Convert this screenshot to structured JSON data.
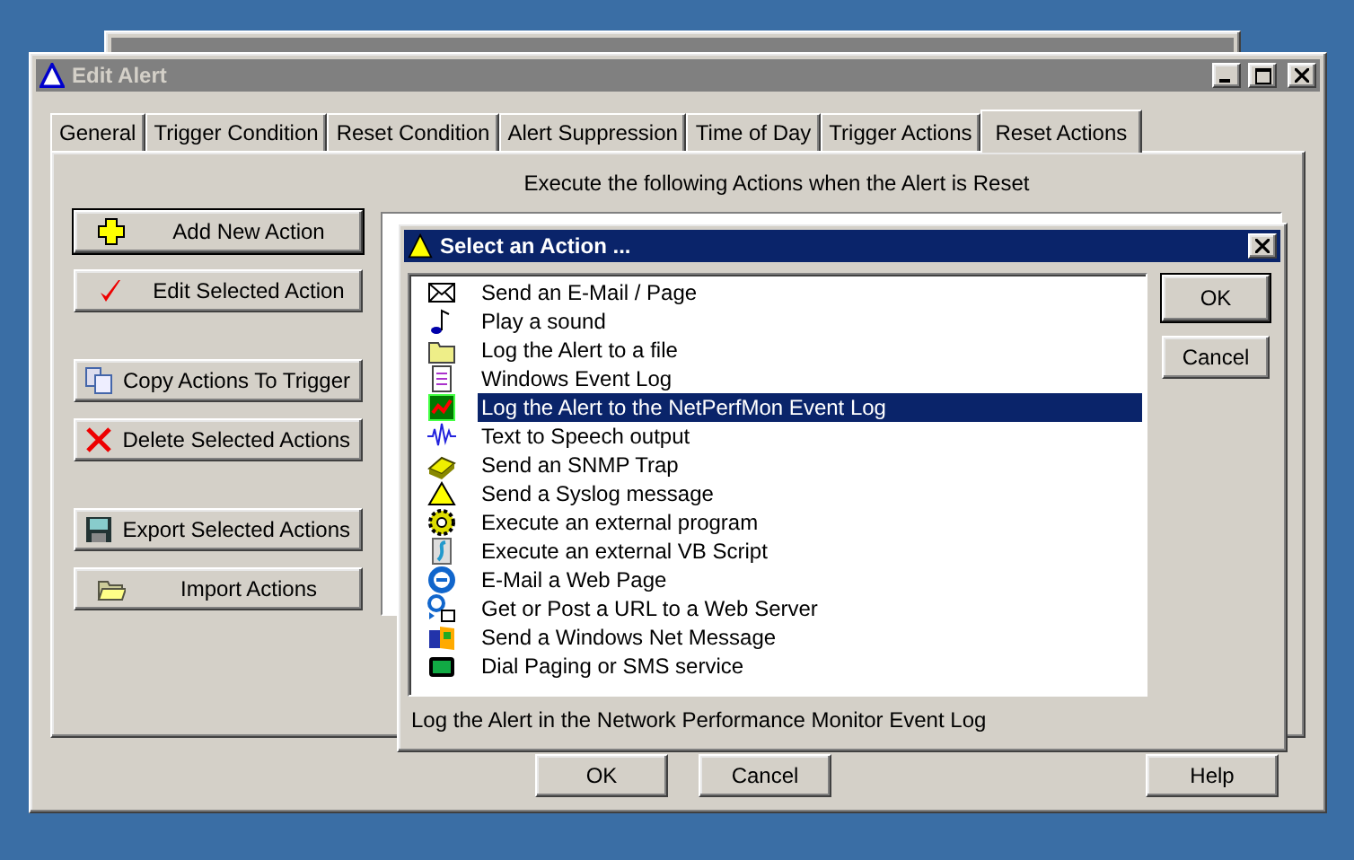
{
  "edit_alert": {
    "title": "Edit Alert",
    "tabs": [
      {
        "label": "General",
        "selected": false
      },
      {
        "label": "Trigger Condition",
        "selected": false
      },
      {
        "label": "Reset Condition",
        "selected": false
      },
      {
        "label": "Alert Suppression",
        "selected": false
      },
      {
        "label": "Time of Day",
        "selected": false
      },
      {
        "label": "Trigger Actions",
        "selected": false
      },
      {
        "label": "Reset Actions",
        "selected": true
      }
    ],
    "heading": "Execute the following Actions when the Alert is Reset",
    "action_button_groups": [
      [
        {
          "label": "Add New Action",
          "default": true
        },
        {
          "label": "Edit Selected Action",
          "default": false
        }
      ],
      [
        {
          "label": "Copy Actions To Trigger",
          "default": false
        },
        {
          "label": "Delete Selected Actions",
          "default": false
        }
      ],
      [
        {
          "label": "Export Selected Actions",
          "default": false
        },
        {
          "label": "Import Actions",
          "default": false
        }
      ]
    ],
    "buttons": [
      {
        "label": "OK"
      },
      {
        "label": "Cancel"
      },
      {
        "label": "Help"
      }
    ]
  },
  "select_action_dialog": {
    "title": "Select an Action ...",
    "actions": [
      {
        "label": "Send an E-Mail / Page",
        "selected": false
      },
      {
        "label": "Play a sound",
        "selected": false
      },
      {
        "label": "Log the Alert to a file",
        "selected": false
      },
      {
        "label": "Windows Event Log",
        "selected": false
      },
      {
        "label": "Log the Alert to the NetPerfMon Event Log",
        "selected": true
      },
      {
        "label": "Text to Speech output",
        "selected": false
      },
      {
        "label": "Send an SNMP Trap",
        "selected": false
      },
      {
        "label": "Send a Syslog message",
        "selected": false
      },
      {
        "label": "Execute an external program",
        "selected": false
      },
      {
        "label": "Execute an external VB Script",
        "selected": false
      },
      {
        "label": "E-Mail a Web Page",
        "selected": false
      },
      {
        "label": "Get or Post a URL to a Web Server",
        "selected": false
      },
      {
        "label": "Send a Windows Net Message",
        "selected": false
      },
      {
        "label": "Dial Paging or SMS service",
        "selected": false
      }
    ],
    "buttons": [
      {
        "label": "OK",
        "default": true
      },
      {
        "label": "Cancel",
        "default": false
      }
    ],
    "description": "Log the Alert in the Network Performance Monitor Event Log"
  }
}
